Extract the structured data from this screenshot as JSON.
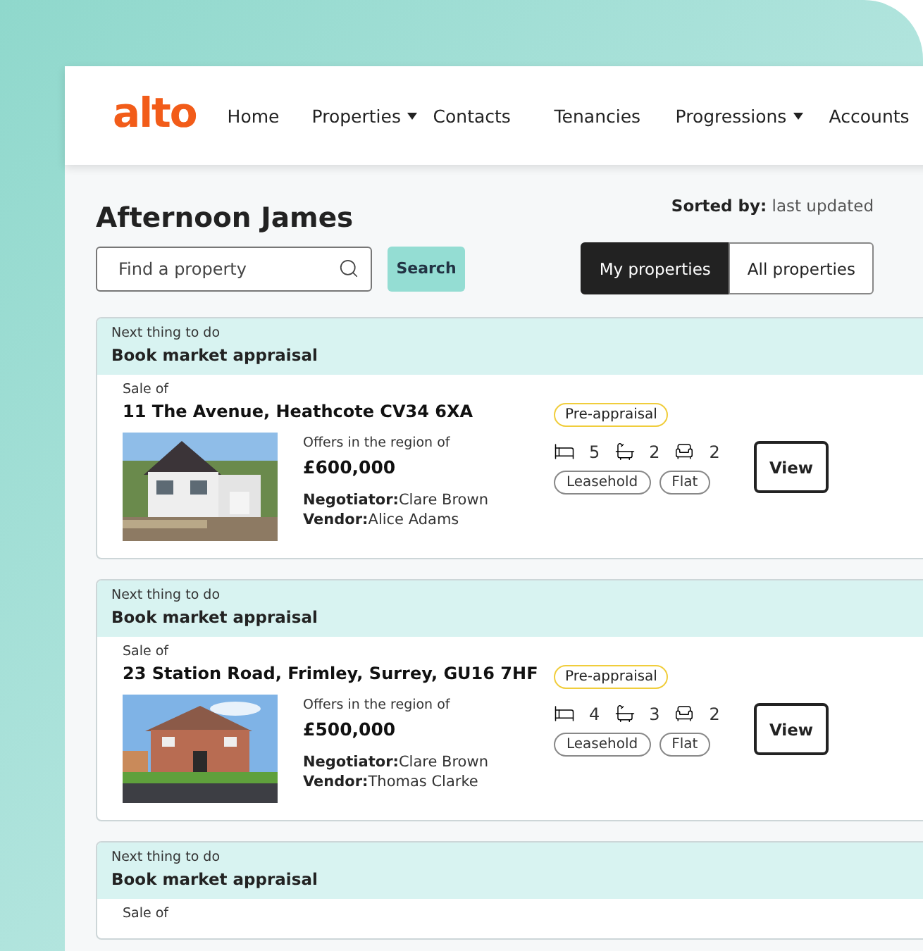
{
  "logo": "alto",
  "nav": [
    {
      "label": "Home",
      "dropdown": false
    },
    {
      "label": "Properties",
      "dropdown": true
    },
    {
      "label": "Contacts",
      "dropdown": false
    },
    {
      "label": "Tenancies",
      "dropdown": false
    },
    {
      "label": "Progressions",
      "dropdown": true
    },
    {
      "label": "Accounts",
      "dropdown": false
    }
  ],
  "greeting": "Afternoon James",
  "sort": {
    "label": "Sorted by:",
    "value": "last updated"
  },
  "search": {
    "placeholder": "Find a property",
    "button": "Search"
  },
  "filter_tabs": [
    {
      "label": "My properties",
      "selected": true
    },
    {
      "label": "All properties",
      "selected": false
    }
  ],
  "listings": [
    {
      "next_label": "Next thing to do",
      "task": "Book market appraisal",
      "sale_of": "Sale of",
      "address": "11 The Avenue, Heathcote CV34 6XA",
      "picture": {
        "kind": "picture"
      },
      "offer_label": "Offers in the region of",
      "price": "£600,000",
      "negotiator_label": "Negotiator:",
      "negotiator": "Clare Brown",
      "vendor_label": "Vendor:",
      "vendor": "Alice Adams",
      "status": "Pre-appraisal",
      "beds": "5",
      "baths": "2",
      "receptions": "2",
      "tags": [
        "Leasehold",
        "Flat"
      ],
      "action": "View"
    },
    {
      "next_label": "Next thing to do",
      "task": "Book market appraisal",
      "sale_of": "Sale of",
      "address": "23 Station Road, Frimley, Surrey, GU16 7HF",
      "picture": {
        "kind": "picture"
      },
      "offer_label": "Offers in the region of",
      "price": "£500,000",
      "negotiator_label": "Negotiator:",
      "negotiator": "Clare Brown",
      "vendor_label": "Vendor:",
      "vendor": "Thomas Clarke",
      "status": "Pre-appraisal",
      "beds": "4",
      "baths": "3",
      "receptions": "2",
      "tags": [
        "Leasehold",
        "Flat"
      ],
      "action": "View"
    },
    {
      "next_label": "Next thing to do",
      "task": "Book market appraisal",
      "sale_of": "Sale of"
    }
  ]
}
